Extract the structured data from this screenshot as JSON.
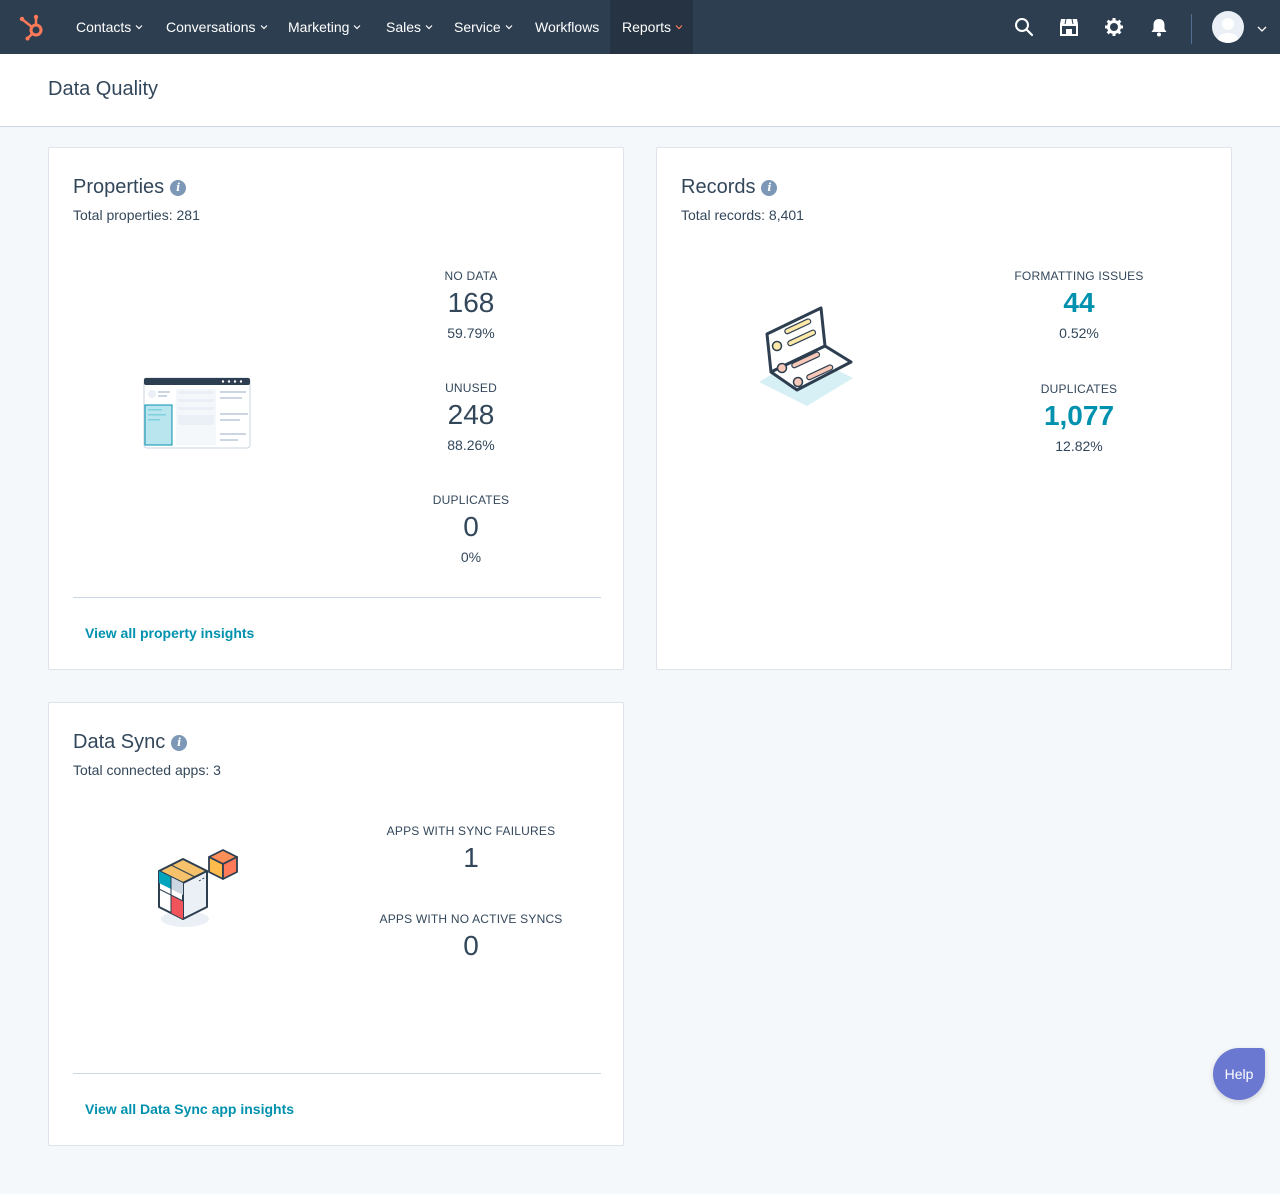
{
  "nav": {
    "items": [
      {
        "label": "Contacts",
        "dropdown": true
      },
      {
        "label": "Conversations",
        "dropdown": true
      },
      {
        "label": "Marketing",
        "dropdown": true
      },
      {
        "label": "Sales",
        "dropdown": true
      },
      {
        "label": "Service",
        "dropdown": true
      },
      {
        "label": "Workflows",
        "dropdown": false
      },
      {
        "label": "Reports",
        "dropdown": true,
        "active": true
      }
    ],
    "icons": [
      "search-icon",
      "marketplace-icon",
      "settings-icon",
      "notifications-icon"
    ]
  },
  "page": {
    "title": "Data Quality"
  },
  "properties": {
    "title": "Properties",
    "subtitle": "Total properties: 281",
    "metrics": [
      {
        "label": "NO DATA",
        "value": "168",
        "pct": "59.79%"
      },
      {
        "label": "UNUSED",
        "value": "248",
        "pct": "88.26%"
      },
      {
        "label": "DUPLICATES",
        "value": "0",
        "pct": "0%"
      }
    ],
    "link": "View all property insights"
  },
  "records": {
    "title": "Records",
    "subtitle": "Total records: 8,401",
    "metrics": [
      {
        "label": "FORMATTING ISSUES",
        "value": "44",
        "pct": "0.52%"
      },
      {
        "label": "DUPLICATES",
        "value": "1,077",
        "pct": "12.82%"
      }
    ]
  },
  "datasync": {
    "title": "Data Sync",
    "subtitle": "Total connected apps: 3",
    "metrics": [
      {
        "label": "APPS WITH SYNC FAILURES",
        "value": "1"
      },
      {
        "label": "APPS WITH NO ACTIVE SYNCS",
        "value": "0"
      }
    ],
    "link": "View all Data Sync app insights"
  },
  "help": {
    "label": "Help"
  },
  "colors": {
    "nav_bg": "#2d3e50",
    "accent": "#ff7a59",
    "link": "#0091ae",
    "help": "#6a78d1"
  }
}
